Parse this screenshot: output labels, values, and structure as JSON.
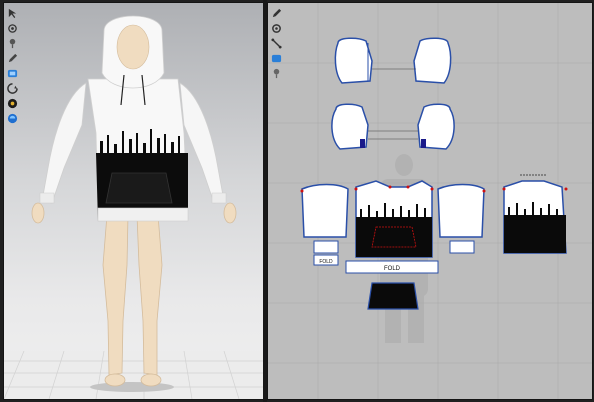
{
  "toolbar_3d": {
    "tools": [
      {
        "icon": "pointer-icon"
      },
      {
        "icon": "transform-icon"
      },
      {
        "icon": "pin-icon"
      },
      {
        "icon": "pen-icon"
      },
      {
        "icon": "fabric-icon"
      },
      {
        "icon": "rotate-icon"
      },
      {
        "icon": "camera-icon"
      },
      {
        "icon": "color-icon"
      }
    ]
  },
  "toolbar_2d": {
    "tools": [
      {
        "icon": "edit-pattern-icon"
      },
      {
        "icon": "settings-icon"
      },
      {
        "icon": "segment-icon"
      },
      {
        "icon": "internal-line-icon"
      },
      {
        "icon": "pin-2d-icon"
      }
    ]
  },
  "patterns": {
    "label_fold": "FOLD",
    "label_fold_pocket": "FOLD"
  },
  "colors": {
    "pattern_outline": "#2a4fa8",
    "pattern_fill": "#ffffff",
    "print_black": "#0a0a0a",
    "point_red": "#d01010"
  }
}
